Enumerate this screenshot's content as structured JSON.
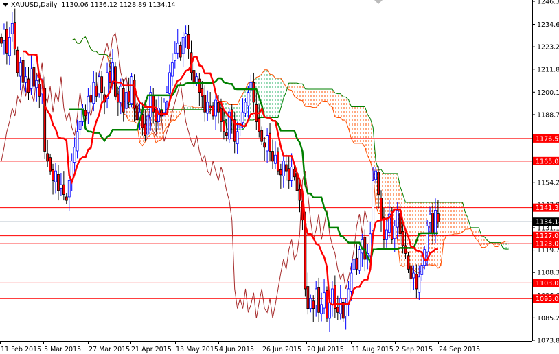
{
  "header": {
    "symbol": "XAUUSD,Daily",
    "ohlc": "1130.06 1136.12 1128.89 1134.14"
  },
  "chart_data": {
    "type": "candlestick",
    "title": "XAUUSD,Daily",
    "indicator": "Ichimoku Kinko Hyo (9,26,52)",
    "closes": [
      1225,
      1232,
      1220,
      1228,
      1235,
      1222,
      1210,
      1215,
      1205,
      1208,
      1200,
      1212,
      1203,
      1206,
      1198,
      1202,
      1170,
      1165,
      1160,
      1155,
      1160,
      1150,
      1153,
      1148,
      1145,
      1155,
      1165,
      1172,
      1180,
      1185,
      1192,
      1188,
      1198,
      1195,
      1205,
      1198,
      1208,
      1200,
      1195,
      1210,
      1205,
      1215,
      1198,
      1195,
      1203,
      1190,
      1200,
      1195,
      1208,
      1192,
      1186,
      1190,
      1182,
      1178,
      1188,
      1200,
      1190,
      1185,
      1192,
      1188,
      1195,
      1200,
      1210,
      1215,
      1220,
      1225,
      1218,
      1228,
      1230,
      1222,
      1210,
      1205,
      1208,
      1200,
      1198,
      1190,
      1195,
      1192,
      1188,
      1196,
      1190,
      1185,
      1180,
      1178,
      1190,
      1186,
      1175,
      1180,
      1184,
      1190,
      1195,
      1200,
      1205,
      1195,
      1185,
      1180,
      1175,
      1172,
      1178,
      1170,
      1165,
      1168,
      1160,
      1158,
      1165,
      1160,
      1155,
      1162,
      1157,
      1150,
      1145,
      1135,
      1100,
      1090,
      1095,
      1090,
      1100,
      1088,
      1092,
      1098,
      1085,
      1093,
      1100,
      1090,
      1088,
      1095,
      1085,
      1092,
      1100,
      1108,
      1115,
      1110,
      1120,
      1125,
      1115,
      1118,
      1128,
      1155,
      1160,
      1148,
      1135,
      1125,
      1130,
      1138,
      1125,
      1132,
      1140,
      1128,
      1122,
      1118,
      1110,
      1105,
      1108,
      1100,
      1106,
      1112,
      1120,
      1132,
      1138,
      1128,
      1140,
      1134.14
    ],
    "last_price": 1134.14,
    "ylim": [
      1073.8,
      1246.3
    ],
    "y_ticks": [
      "1246.30",
      "1234.60",
      "1223.20",
      "1211.80",
      "1200.10",
      "1188.70",
      "1154.20",
      "1143.00",
      "1131.10",
      "1119.70",
      "1108.30",
      "1096.60",
      "1085.20",
      "1073.80"
    ],
    "x_ticks": [
      "11 Feb 2015",
      "5 Mar 2015",
      "27 Mar 2015",
      "21 Apr 2015",
      "13 May 2015",
      "4 Jun 2015",
      "26 Jun 2015",
      "20 Jul 2015",
      "11 Aug 2015",
      "2 Sep 2015",
      "24 Sep 2015"
    ],
    "levels": [
      {
        "value": 1176.5,
        "label": "1176.50"
      },
      {
        "value": 1165.0,
        "label": "1165.00"
      },
      {
        "value": 1141.31,
        "label": "1141.31"
      },
      {
        "value": 1127.0,
        "label": "1127.00"
      },
      {
        "value": 1123.0,
        "label": "1123.00"
      },
      {
        "value": 1103.0,
        "label": "1103.00"
      },
      {
        "value": 1095.0,
        "label": "1095.00"
      }
    ],
    "colors": {
      "level": "#ff0000",
      "bull": "#0000ff",
      "bear": "#ff0000",
      "tenkan": "#ff0000",
      "kijun": "#008000",
      "chikou": "#a52a2a",
      "cloud_up": "#20b060",
      "cloud_down": "#ff5000",
      "price_line": "#778899"
    }
  }
}
